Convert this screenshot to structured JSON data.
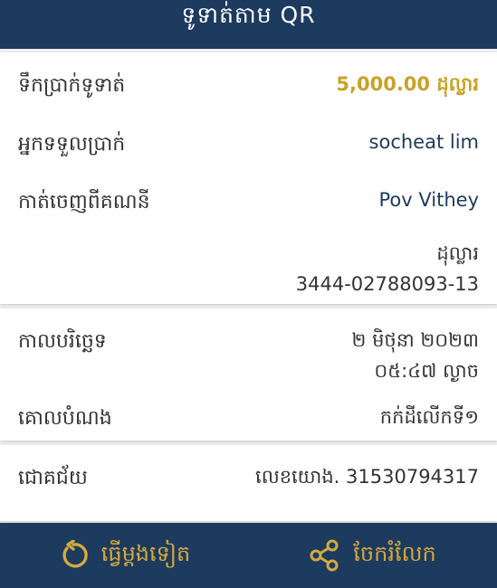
{
  "header": {
    "title": "ទូទាត់តាម QR"
  },
  "details": {
    "amount_label": "ទឹកប្រាក់ទូទាត់",
    "amount_value": "5,000.00 ដុល្លារ",
    "receiver_label": "អ្នកទទួលប្រាក់",
    "receiver_value": "socheat lim",
    "from_label": "កាត់ចេញពីគណនី",
    "from_value": "Pov Vithey",
    "currency_value": "ដុល្លារ",
    "account_number": "3444-02788093-13"
  },
  "meta": {
    "date_label": "កាលបរិច្ឆេទ",
    "date_value": "២ មិថុនា ២០២៣",
    "time_value": "០៥:៤៧ ល្ងាច",
    "purpose_label": "គោលបំណង",
    "purpose_value": "កក់ដីលើកទី១"
  },
  "result": {
    "status_label": "ជោគជ័យ",
    "reference_value": "លេខយោង. 31530794317"
  },
  "footer": {
    "repeat_label": "ធ្វើម្តងទៀត",
    "share_label": "ចែករំលែក"
  },
  "colors": {
    "header_bg": "#1d3a5f",
    "accent_gold": "#c9a227",
    "navy_text": "#1d3a5f"
  },
  "icons": {
    "repeat": "refresh-icon",
    "share": "share-icon"
  }
}
